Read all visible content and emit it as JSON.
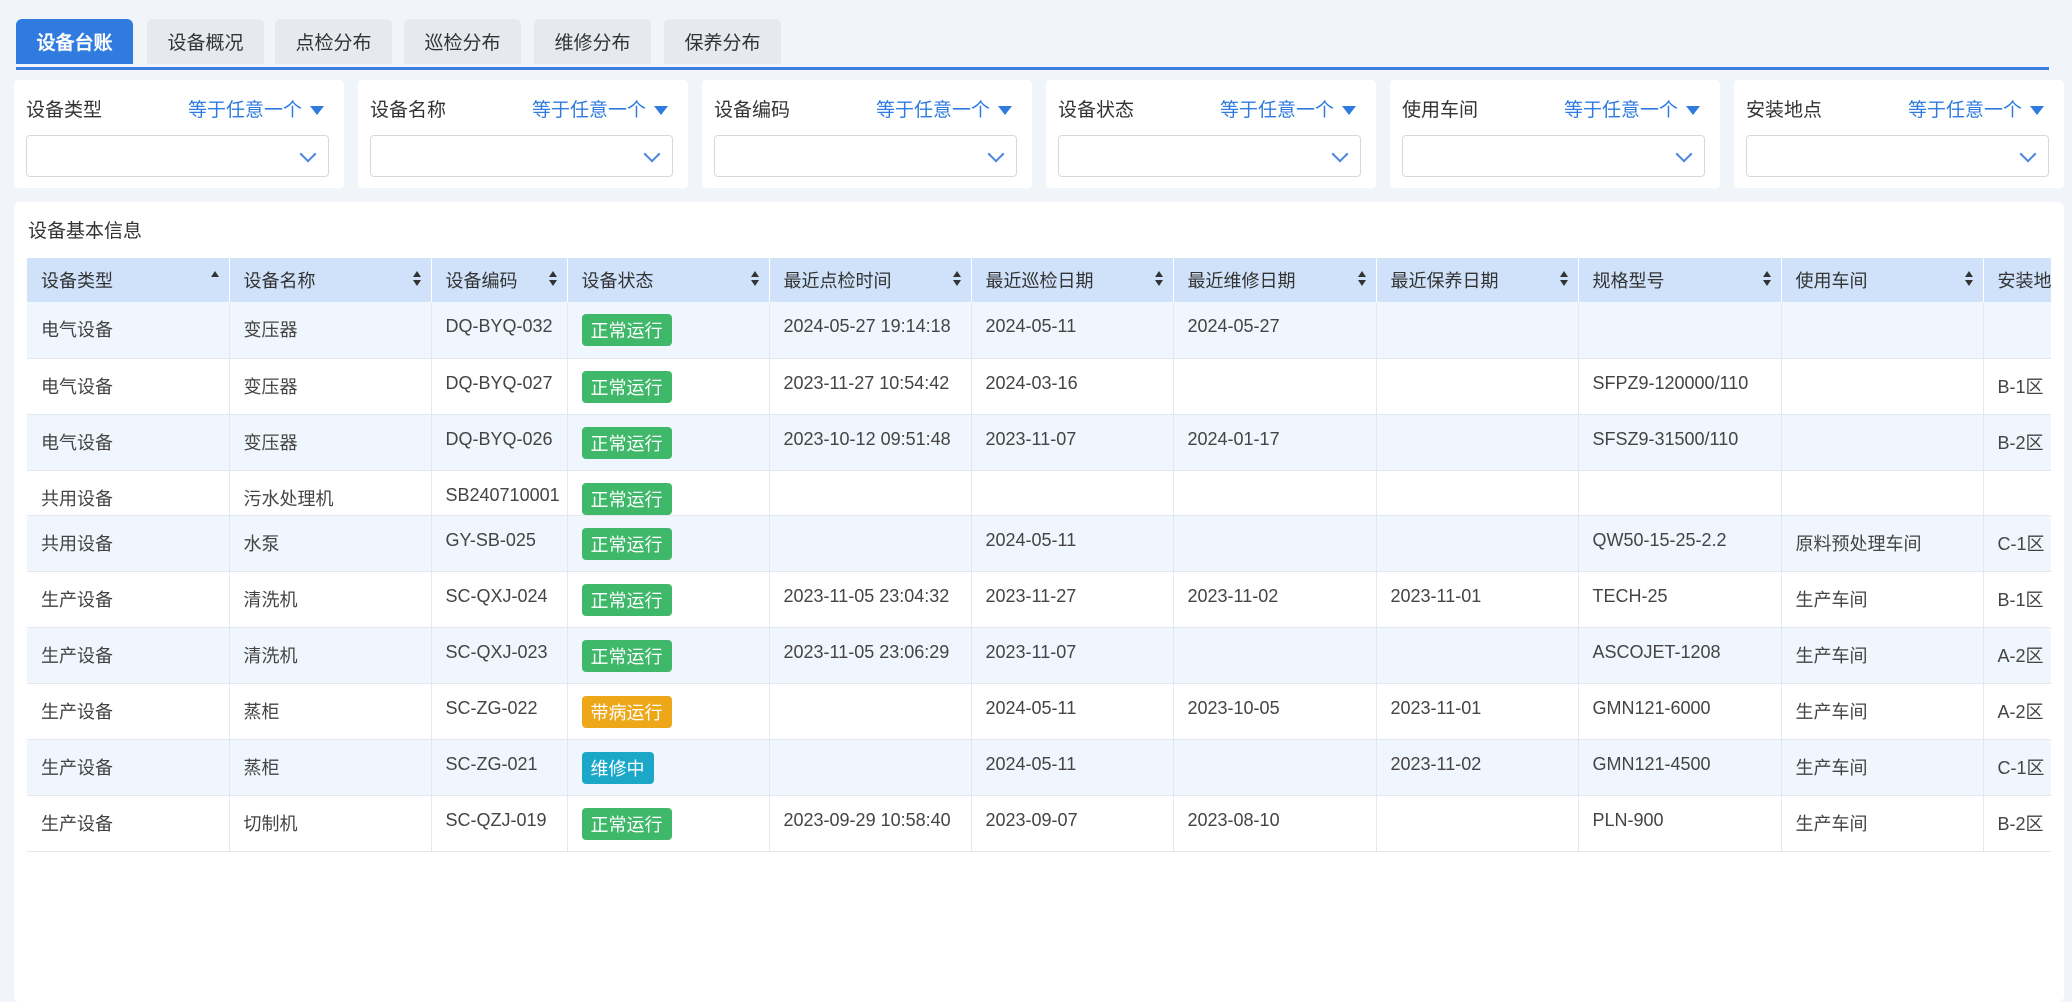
{
  "tabs": [
    "设备台账",
    "设备概况",
    "点检分布",
    "巡检分布",
    "维修分布",
    "保养分布"
  ],
  "filters": [
    {
      "label": "设备类型",
      "op": "等于任意一个"
    },
    {
      "label": "设备名称",
      "op": "等于任意一个"
    },
    {
      "label": "设备编码",
      "op": "等于任意一个"
    },
    {
      "label": "设备状态",
      "op": "等于任意一个"
    },
    {
      "label": "使用车间",
      "op": "等于任意一个"
    },
    {
      "label": "安装地点",
      "op": "等于任意一个"
    }
  ],
  "panel_title": "设备基本信息",
  "columns": [
    "设备类型",
    "设备名称",
    "设备编码",
    "设备状态",
    "最近点检时间",
    "最近巡检日期",
    "最近维修日期",
    "最近保养日期",
    "规格型号",
    "使用车间",
    "安装地点"
  ],
  "rows": [
    {
      "type": "电气设备",
      "name": "变压器",
      "code": "DQ-BYQ-032",
      "status": "正常运行",
      "status_kind": "ok",
      "check": "2024-05-27 19:14:18",
      "patrol": "2024-05-11",
      "repair": "2024-05-27",
      "maint": "",
      "spec": "",
      "shop": "",
      "loc": "",
      "tall": true
    },
    {
      "type": "电气设备",
      "name": "变压器",
      "code": "DQ-BYQ-027",
      "status": "正常运行",
      "status_kind": "ok",
      "check": "2023-11-27 10:54:42",
      "patrol": "2024-03-16",
      "repair": "",
      "maint": "",
      "spec": "SFPZ9-120000/110",
      "shop": "",
      "loc": "B-1区",
      "tall": true
    },
    {
      "type": "电气设备",
      "name": "变压器",
      "code": "DQ-BYQ-026",
      "status": "正常运行",
      "status_kind": "ok",
      "check": "2023-10-12 09:51:48",
      "patrol": "2023-11-07",
      "repair": "2024-01-17",
      "maint": "",
      "spec": "SFSZ9-31500/110",
      "shop": "",
      "loc": "B-2区",
      "tall": true
    },
    {
      "type": "共用设备",
      "name": "污水处理机",
      "code": "SB240710001",
      "status": "正常运行",
      "status_kind": "ok",
      "check": "",
      "patrol": "",
      "repair": "",
      "maint": "",
      "spec": "",
      "shop": "",
      "loc": "",
      "tall": false
    },
    {
      "type": "共用设备",
      "name": "水泵",
      "code": "GY-SB-025",
      "status": "正常运行",
      "status_kind": "ok",
      "check": "",
      "patrol": "2024-05-11",
      "repair": "",
      "maint": "",
      "spec": "QW50-15-25-2.2",
      "shop": "原料预处理车间",
      "loc": "C-1区",
      "tall": true
    },
    {
      "type": "生产设备",
      "name": "清洗机",
      "code": "SC-QXJ-024",
      "status": "正常运行",
      "status_kind": "ok",
      "check": "2023-11-05 23:04:32",
      "patrol": "2023-11-27",
      "repair": "2023-11-02",
      "maint": "2023-11-01",
      "spec": "TECH-25",
      "shop": "生产车间",
      "loc": "B-1区",
      "tall": true
    },
    {
      "type": "生产设备",
      "name": "清洗机",
      "code": "SC-QXJ-023",
      "status": "正常运行",
      "status_kind": "ok",
      "check": "2023-11-05 23:06:29",
      "patrol": "2023-11-07",
      "repair": "",
      "maint": "",
      "spec": "ASCOJET-1208",
      "shop": "生产车间",
      "loc": "A-2区",
      "tall": true
    },
    {
      "type": "生产设备",
      "name": "蒸柜",
      "code": "SC-ZG-022",
      "status": "带病运行",
      "status_kind": "warn",
      "check": "",
      "patrol": "2024-05-11",
      "repair": "2023-10-05",
      "maint": "2023-11-01",
      "spec": "GMN121-6000",
      "shop": "生产车间",
      "loc": "A-2区",
      "tall": true
    },
    {
      "type": "生产设备",
      "name": "蒸柜",
      "code": "SC-ZG-021",
      "status": "维修中",
      "status_kind": "repair",
      "check": "",
      "patrol": "2024-05-11",
      "repair": "",
      "maint": "2023-11-02",
      "spec": "GMN121-4500",
      "shop": "生产车间",
      "loc": "C-1区",
      "tall": true
    },
    {
      "type": "生产设备",
      "name": "切制机",
      "code": "SC-QZJ-019",
      "status": "正常运行",
      "status_kind": "ok",
      "check": "2023-09-29 10:58:40",
      "patrol": "2023-09-07",
      "repair": "2023-08-10",
      "maint": "",
      "spec": "PLN-900",
      "shop": "生产车间",
      "loc": "B-2区",
      "tall": true
    }
  ]
}
